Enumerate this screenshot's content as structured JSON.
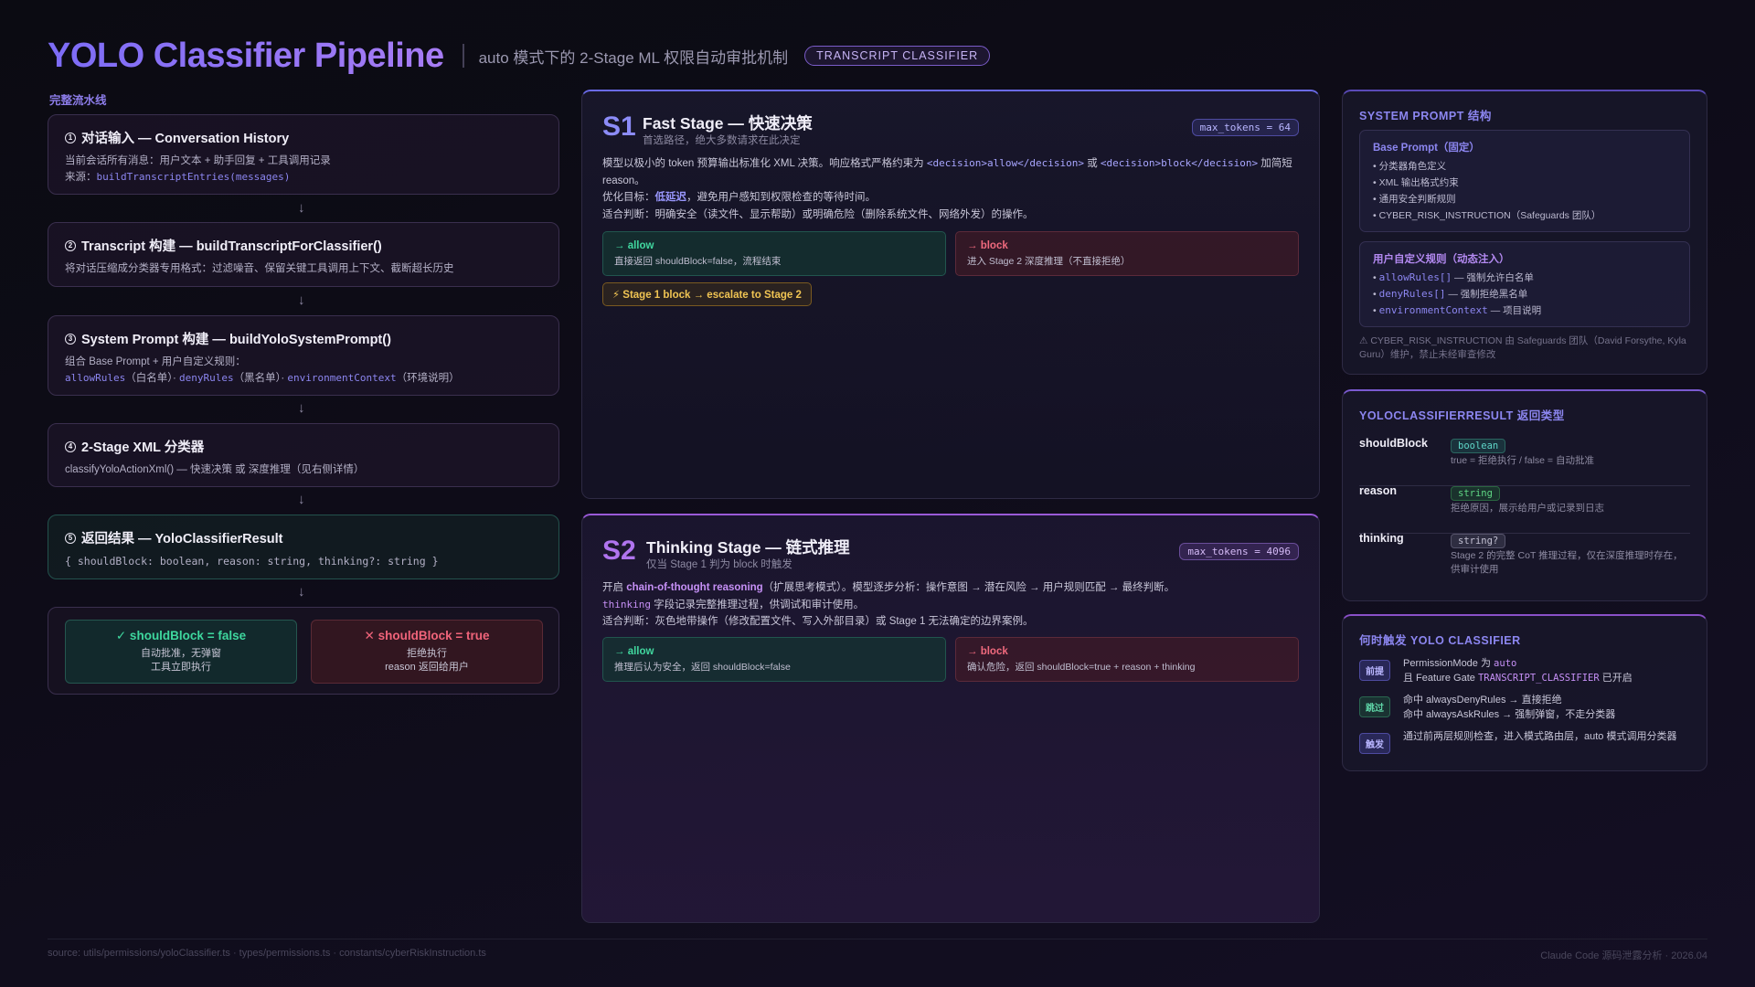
{
  "header": {
    "title": "YOLO Classifier Pipeline",
    "subtitle": "auto 模式下的 2-Stage ML 权限自动审批机制",
    "tag": "TRANSCRIPT CLASSIFIER"
  },
  "pipeline": {
    "label": "完整流水线",
    "steps": [
      {
        "title": "对话输入 — Conversation History",
        "line1": "当前会话所有消息：用户文本 + 助手回复 + 工具调用记录",
        "line2_prefix": "来源：",
        "line2_code": "buildTranscriptEntries(messages)"
      },
      {
        "title": "Transcript 构建 — buildTranscriptForClassifier()",
        "line1": "将对话压缩成分类器专用格式：过滤噪音、保留关键工具调用上下文、截断超长历史"
      },
      {
        "title": "System Prompt 构建 — buildYoloSystemPrompt()",
        "line1": "组合 Base Prompt + 用户自定义规则：",
        "c1": "allowRules",
        "t1": "（白名单）· ",
        "c2": "denyRules",
        "t2": "（黑名单）· ",
        "c3": "environmentContext",
        "t3": "（环境说明）"
      },
      {
        "title": "2-Stage XML 分类器",
        "line1": "classifyYoloActionXml() — 快速决策 或 深度推理（见右侧详情）"
      },
      {
        "title": "返回结果 — YoloClassifierResult",
        "line1": "{ shouldBlock: boolean, reason: string, thinking?: string }"
      }
    ],
    "arrow": "↓",
    "results": {
      "ok_title": "✓ shouldBlock = false",
      "ok_l1": "自动批准，无弹窗",
      "ok_l2": "工具立即执行",
      "no_title": "✕ shouldBlock = true",
      "no_l1": "拒绝执行",
      "no_l2": "reason 返回给用户"
    }
  },
  "s1": {
    "big": "S1",
    "title": "Fast Stage — 快速决策",
    "subtitle": "首选路径，绝大多数请求在此决定",
    "tokens": "max_tokens = 64",
    "p1a": "模型以极小的 token 预算输出标准化 XML 决策。响应格式严格约束为 ",
    "p1c1": "<decision>allow</decision>",
    "p1b": " 或 ",
    "p1c2": "<decision>block</decision>",
    "p1d": " 加简短 reason。",
    "p2a": "优化目标：",
    "p2hl": "低延迟",
    "p2b": "，避免用户感知到权限检查的等待时间。",
    "p3": "适合判断：明确安全（读文件、显示帮助）或明确危险（删除系统文件、网络外发）的操作。",
    "allow_h": "→ allow",
    "allow_l": "直接返回 shouldBlock=false，流程结束",
    "block_h": "→ block",
    "block_l": "进入 Stage 2 深度推理（不直接拒绝）",
    "escalate": "⚡ Stage 1 block → escalate to Stage 2"
  },
  "s2": {
    "big": "S2",
    "title": "Thinking Stage — 链式推理",
    "subtitle": "仅当 Stage 1 判为 block 时触发",
    "tokens": "max_tokens = 4096",
    "p1a": "开启 ",
    "p1hl": "chain-of-thought reasoning",
    "p1b": "（扩展思考模式）。模型逐步分析：操作意图 → 潜在风险 → 用户规则匹配 → 最终判断。",
    "p2c": "thinking",
    "p2b": " 字段记录完整推理过程，供调试和审计使用。",
    "p3": "适合判断：灰色地带操作（修改配置文件、写入外部目录）或 Stage 1 无法确定的边界案例。",
    "allow_h": "→ allow",
    "allow_l": "推理后认为安全，返回 shouldBlock=false",
    "block_h": "→ block",
    "block_l": "确认危险，返回 shouldBlock=true + reason + thinking"
  },
  "prompt_panel": {
    "title": "SYSTEM PROMPT 结构",
    "base_title": "Base Prompt（固定）",
    "base_items": [
      "• 分类器角色定义",
      "• XML 输出格式约束",
      "• 通用安全判断规则",
      "• CYBER_RISK_INSTRUCTION（Safeguards 团队）"
    ],
    "user_title": "用户自定义规则（动态注入）",
    "user_items": [
      {
        "code": "allowRules[]",
        "text": " — 强制允许白名单"
      },
      {
        "code": "denyRules[]",
        "text": " — 强制拒绝黑名单"
      },
      {
        "code": "environmentContext",
        "text": " — 项目说明"
      }
    ],
    "note": "⚠ CYBER_RISK_INSTRUCTION 由 Safeguards 团队（David Forsythe, Kyla Guru）维护，禁止未经审查修改"
  },
  "result_panel": {
    "title": "YOLOCLASSIFIERRESULT 返回类型",
    "rows": [
      {
        "key": "shouldBlock",
        "type": "boolean",
        "desc": "true = 拒绝执行 / false = 自动批准"
      },
      {
        "key": "reason",
        "type": "string",
        "desc": "拒绝原因，展示给用户或记录到日志"
      },
      {
        "key": "thinking",
        "type": "string?",
        "desc": "Stage 2 的完整 CoT 推理过程，仅在深度推理时存在，供审计使用"
      }
    ]
  },
  "trigger_panel": {
    "title": "何时触发 YOLO CLASSIFIER",
    "rows": [
      {
        "badge": "前提",
        "l1a": "PermissionMode 为 ",
        "l1c": "auto",
        "l2a": "且 Feature Gate ",
        "l2c": "TRANSCRIPT_CLASSIFIER",
        "l2b": " 已开启"
      },
      {
        "badge": "跳过",
        "l1": "命中 alwaysDenyRules → 直接拒绝",
        "l2": "命中 alwaysAskRules → 强制弹窗，不走分类器"
      },
      {
        "badge": "触发",
        "l1": "通过前两层规则检查，进入模式路由层，auto 模式调用分类器"
      }
    ]
  },
  "footer": {
    "left": "source: utils/permissions/yoloClassifier.ts · types/permissions.ts · constants/cyberRiskInstruction.ts",
    "right": "Claude Code 源码泄露分析 · 2026.04"
  }
}
